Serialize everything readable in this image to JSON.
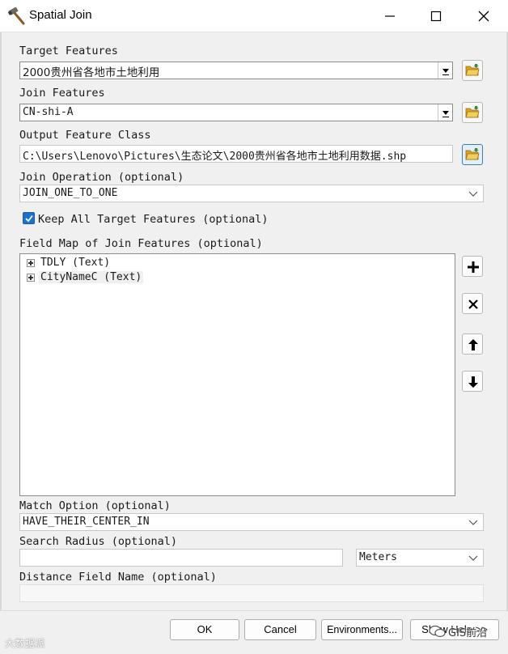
{
  "window": {
    "title": "Spatial Join"
  },
  "target_features": {
    "label": "Target Features",
    "value": "2000贵州省各地市土地利用"
  },
  "join_features": {
    "label": "Join Features",
    "value": "CN-shi-A"
  },
  "output_feature_class": {
    "label": "Output Feature Class",
    "value": "C:\\Users\\Lenovo\\Pictures\\生态论文\\2000贵州省各地市土地利用数据.shp"
  },
  "join_operation": {
    "label": "Join Operation (optional)",
    "value": "JOIN_ONE_TO_ONE"
  },
  "keep_all": {
    "label": "Keep All Target Features (optional)",
    "checked": true
  },
  "field_map": {
    "label": "Field Map of Join Features (optional)",
    "items": [
      {
        "text": "TDLY (Text)"
      },
      {
        "text": "CityNameC (Text)"
      }
    ],
    "tools": [
      "add-icon",
      "remove-icon",
      "move-up-icon",
      "move-down-icon"
    ]
  },
  "match_option": {
    "label": "Match Option (optional)",
    "value": "HAVE_THEIR_CENTER_IN"
  },
  "search_radius": {
    "label": "Search Radius (optional)",
    "value": "",
    "unit": "Meters"
  },
  "distance_field": {
    "label": "Distance Field Name (optional)",
    "value": ""
  },
  "buttons": {
    "ok": "OK",
    "cancel": "Cancel",
    "environments": "Environments...",
    "show_help": "Show Help >>"
  },
  "watermarks": {
    "left": "大数据派",
    "right": "GIS前沿"
  },
  "colors": {
    "accent": "#1a73c9",
    "panel": "#f0f0f0",
    "folder": "#e8b73a"
  }
}
